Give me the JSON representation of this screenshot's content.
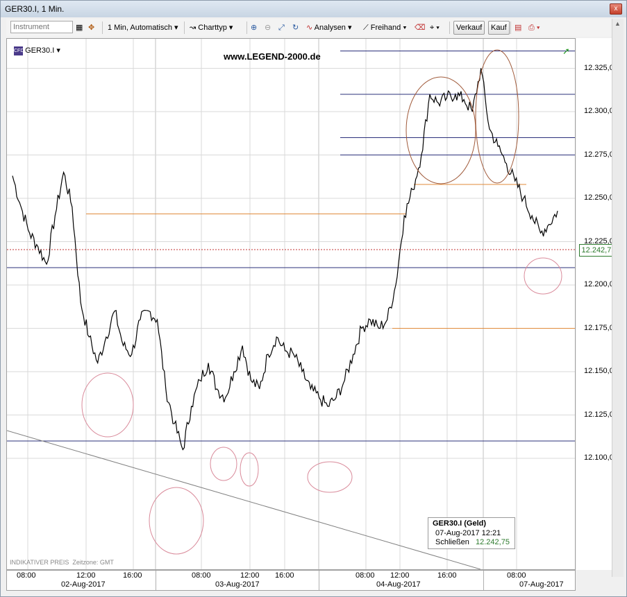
{
  "window": {
    "title": "GER30.I, 1 Min.",
    "close_label": "x"
  },
  "toolbar": {
    "instrument_placeholder": "Instrument",
    "interval_label": "1 Min,  Automatisch",
    "charttype_label": "Charttyp",
    "analysen_label": "Analysen",
    "freihand_label": "Freihand",
    "verkauf_label": "Verkauf",
    "kauf_label": "Kauf"
  },
  "chart": {
    "instrument_label": "GER30.I",
    "watermark": "www.LEGEND-2000.de",
    "footer_note": "INDIKATIVER PREIS",
    "timezone_note": "Zeitzone: GMT",
    "current_price_label": "12.242,75",
    "price_ticks": [
      "12.325,00",
      "12.300,00",
      "12.275,00",
      "12.250,00",
      "12.225,00",
      "12.200,00",
      "12.175,00",
      "12.150,00",
      "12.125,00",
      "12.100,00"
    ],
    "time_ticks": [
      "08:00",
      "12:00",
      "16:00",
      "08:00",
      "12:00",
      "16:00",
      "08:00",
      "12:00",
      "16:00",
      "08:00"
    ],
    "date_ticks": [
      "02-Aug-2017",
      "03-Aug-2017",
      "04-Aug-2017",
      "07-Aug-2017"
    ]
  },
  "legend": {
    "title": "GER30.I (Geld)",
    "timestamp": "07-Aug-2017 12:21",
    "close_label": "Schließen",
    "close_value": "12.242,75"
  },
  "colors": {
    "price_line": "#000000",
    "hline_blue": "#2a2f7a",
    "hline_orange": "#e08a3a",
    "circle_pink": "#d98a9a",
    "circle_brown": "#a05a3a",
    "marker_green": "#2c7a2c"
  },
  "chart_data": {
    "type": "line",
    "title": "",
    "xlabel": "",
    "ylabel": "",
    "ylim": [
      12090,
      12340
    ],
    "dates": [
      "02-Aug-2017",
      "03-Aug-2017",
      "04-Aug-2017",
      "07-Aug-2017"
    ],
    "series": [
      {
        "name": "GER30.I",
        "values": [
          12263,
          12245,
          12230,
          12222,
          12212,
          12240,
          12265,
          12245,
          12190,
          12170,
          12155,
          12170,
          12185,
          12165,
          12160,
          12180,
          12185,
          12180,
          12140,
          12120,
          12105,
          12130,
          12145,
          12155,
          12140,
          12135,
          12150,
          12165,
          12145,
          12140,
          12160,
          12170,
          12162,
          12160,
          12150,
          12140,
          12135,
          12130,
          12135,
          12145,
          12160,
          12175,
          12180,
          12175,
          12180,
          12200,
          12240,
          12255,
          12275,
          12310,
          12305,
          12308,
          12310,
          12307,
          12300,
          12325,
          12290,
          12280,
          12270,
          12260,
          12250,
          12240,
          12230,
          12235,
          12242.75
        ]
      }
    ],
    "horizontal_levels_blue": [
      12335,
      12310,
      12285,
      12275,
      12210,
      12110
    ],
    "horizontal_levels_orange": [
      12258,
      12241,
      12175
    ],
    "current_price": 12242.75
  }
}
